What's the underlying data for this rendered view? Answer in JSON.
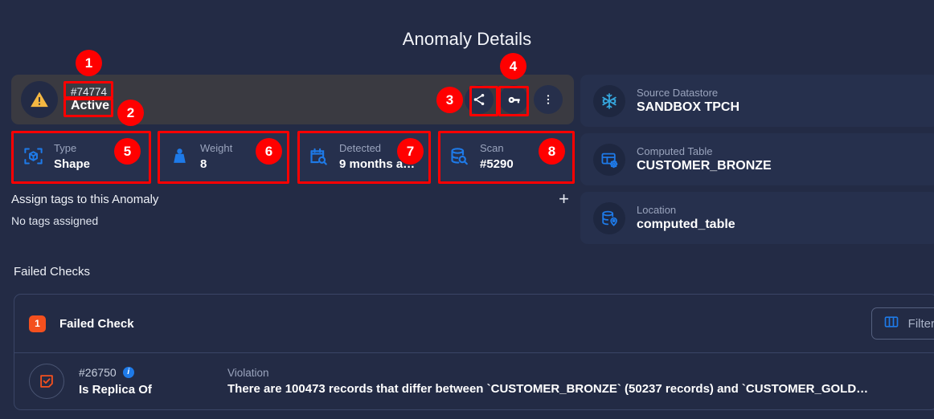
{
  "page": {
    "title": "Anomaly Details",
    "accent_blue": "#1e7ae8",
    "accent_orange": "#f4501e",
    "background": "#232b45",
    "card_background": "#26304d",
    "status_bar_background": "#3a3a41"
  },
  "status_bar": {
    "icon": "warning-triangle-icon",
    "anomaly_id": "#74774",
    "state": "Active",
    "actions": [
      {
        "name": "share-button",
        "icon": "share-icon"
      },
      {
        "name": "key-button",
        "icon": "key-icon"
      },
      {
        "name": "more-options-button",
        "icon": "vertical-dots-icon"
      }
    ]
  },
  "info_cards": [
    {
      "icon": "shape-cube-icon",
      "label": "Type",
      "value": "Shape"
    },
    {
      "icon": "weight-icon",
      "label": "Weight",
      "value": "8"
    },
    {
      "icon": "calendar-search-icon",
      "label": "Detected",
      "value": "9 months a…"
    },
    {
      "icon": "database-search-icon",
      "label": "Scan",
      "value": "#5290"
    }
  ],
  "tags": {
    "title": "Assign tags to this Anomaly",
    "empty_text": "No tags assigned",
    "add_label": "+"
  },
  "side_cards": [
    {
      "icon": "snowflake-icon",
      "label": "Source Datastore",
      "value": "SANDBOX TPCH"
    },
    {
      "icon": "computed-table-icon",
      "label": "Computed Table",
      "value": "CUSTOMER_BRONZE"
    },
    {
      "icon": "database-location-icon",
      "label": "Location",
      "value": "computed_table"
    }
  ],
  "failed_checks": {
    "heading": "Failed Checks",
    "count_badge": "1",
    "panel_title": "Failed Check",
    "filter_label": "Filter",
    "filter_icon": "columns-icon",
    "columns": {
      "violation": "Violation"
    },
    "rows": [
      {
        "icon": "check-square-icon",
        "id": "#26750",
        "info_icon": "i",
        "name": "Is Replica Of",
        "violation_label": "Violation",
        "violation": "There are 100473 records that differ between `CUSTOMER_BRONZE` (50237 records) and `CUSTOMER_GOLD…"
      }
    ]
  },
  "annotations": [
    {
      "num": "1"
    },
    {
      "num": "2"
    },
    {
      "num": "3"
    },
    {
      "num": "4"
    },
    {
      "num": "5"
    },
    {
      "num": "6"
    },
    {
      "num": "7"
    },
    {
      "num": "8"
    }
  ]
}
